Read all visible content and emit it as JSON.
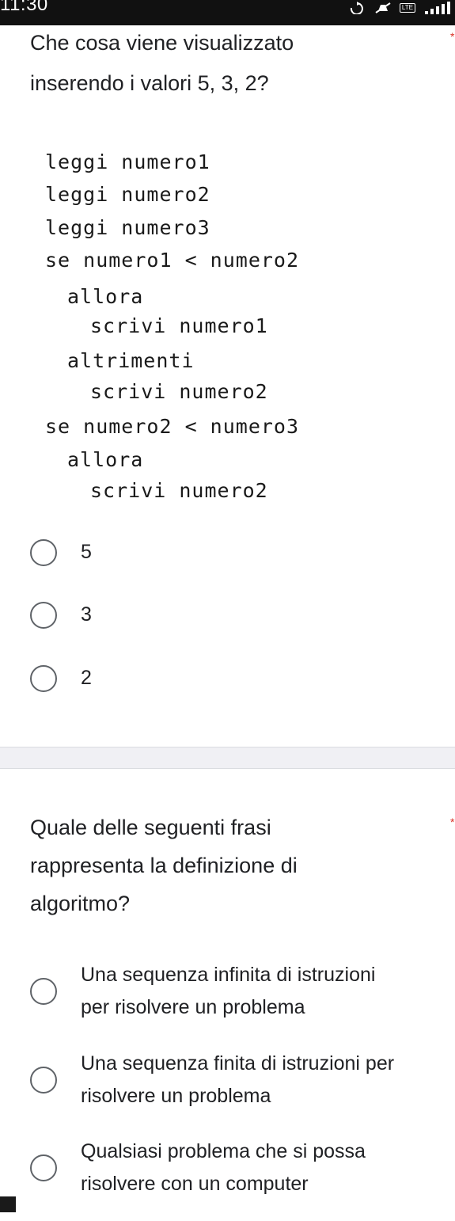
{
  "status_bar": {
    "time": "11:30",
    "icons": [
      "sync-icon",
      "mute-icon",
      "lte-icon",
      "signal-icon"
    ],
    "lte_label": "LTE"
  },
  "question1": {
    "title_lines": [
      "Che cosa viene visualizzato",
      "inserendo i valori 5, 3, 2?"
    ],
    "required_mark": "*",
    "code_lines": [
      "leggi numero1",
      "leggi numero2",
      "leggi numero3",
      "se numero1 < numero2",
      "allora",
      "scrivi numero1",
      "altrimenti",
      "scrivi numero2",
      "se numero2 < numero3",
      "allora",
      "scrivi numero2"
    ],
    "options": [
      "5",
      "3",
      "2"
    ]
  },
  "question2": {
    "title_lines": [
      "Quale delle seguenti frasi",
      "rappresenta la definizione di",
      "algoritmo?"
    ],
    "required_mark": "*",
    "options": [
      [
        "Una sequenza infinita di istruzioni",
        "per risolvere un problema"
      ],
      [
        "Una sequenza finita di istruzioni per",
        "risolvere un problema"
      ],
      [
        "Qualsiasi problema che si possa",
        "risolvere con un computer"
      ]
    ]
  },
  "colors": {
    "status_bar": "#111111",
    "text": "#202124",
    "radio_border": "#5f6368",
    "separator": "#f0f0f4",
    "required": "#d93025"
  }
}
